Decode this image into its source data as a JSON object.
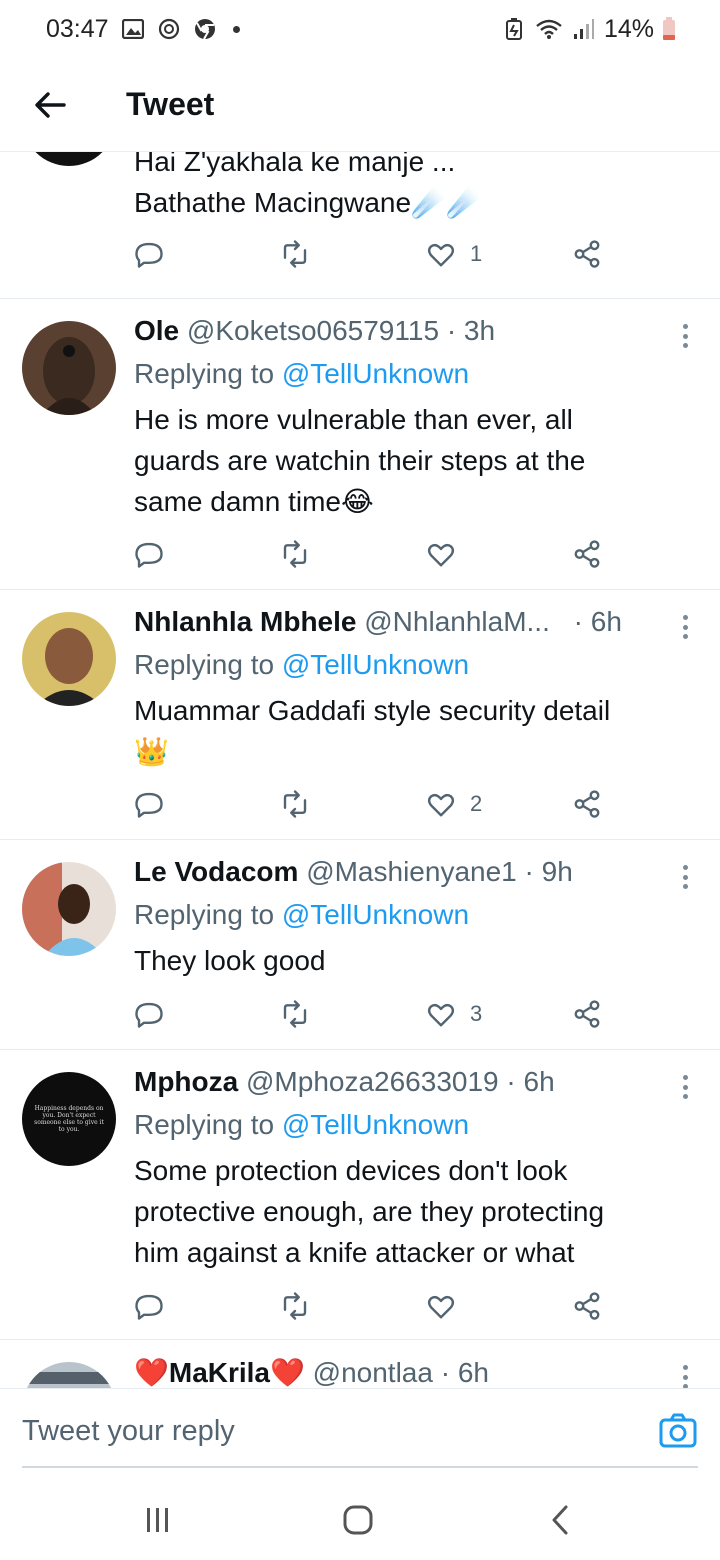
{
  "status_bar": {
    "time": "03:47",
    "battery": "14%",
    "left_icons": [
      "gallery-icon",
      "chat-icon",
      "chrome-icon"
    ],
    "right_icons": [
      "battery-saver-icon",
      "wifi-icon",
      "signal-icon",
      "battery-icon"
    ]
  },
  "header": {
    "title": "Tweet"
  },
  "tweets": [
    {
      "partial": true,
      "text_lines": [
        "Hai Z'yakhala ke manje ...",
        "Bathathe Macingwane☄️☄️"
      ],
      "likes": "1"
    },
    {
      "name": "Ole",
      "handle": "@Koketso06579115",
      "time": "· 3h",
      "replying_prefix": "Replying to",
      "replying_to": "@TellUnknown",
      "text_lines": [
        "He is more vulnerable than ever, all",
        "guards are watchin their steps at the",
        "same damn time😂"
      ],
      "likes": ""
    },
    {
      "name": "Nhlanhla Mbhele",
      "handle": "@NhlanhlaM...",
      "time": "· 6h",
      "replying_prefix": "Replying to",
      "replying_to": "@TellUnknown",
      "text_lines": [
        "Muammar Gaddafi style security detail",
        "👑"
      ],
      "likes": "2"
    },
    {
      "name": "Le Vodacom",
      "handle": "@Mashienyane1",
      "time": "· 9h",
      "replying_prefix": "Replying to",
      "replying_to": "@TellUnknown",
      "text_lines": [
        "They look good"
      ],
      "likes": "3"
    },
    {
      "name": "Mphoza",
      "handle": "@Mphoza26633019",
      "time": "· 6h",
      "replying_prefix": "Replying to",
      "replying_to": "@TellUnknown",
      "text_lines": [
        "Some protection devices don't look",
        "protective enough, are they protecting",
        "him against a knife attacker or what"
      ],
      "likes": "",
      "avatar_text": "Happiness depends on you. Don't expect someone else to give it to you."
    },
    {
      "name": "❤️MaKrila❤️",
      "handle": "@nontlaa",
      "time": "· 6h",
      "partial": true
    }
  ],
  "compose": {
    "placeholder": "Tweet your reply"
  },
  "colors": {
    "accent": "#1d9bf0",
    "text": "#0f1419",
    "secondary": "#536471",
    "divider": "#e6ecf0"
  }
}
